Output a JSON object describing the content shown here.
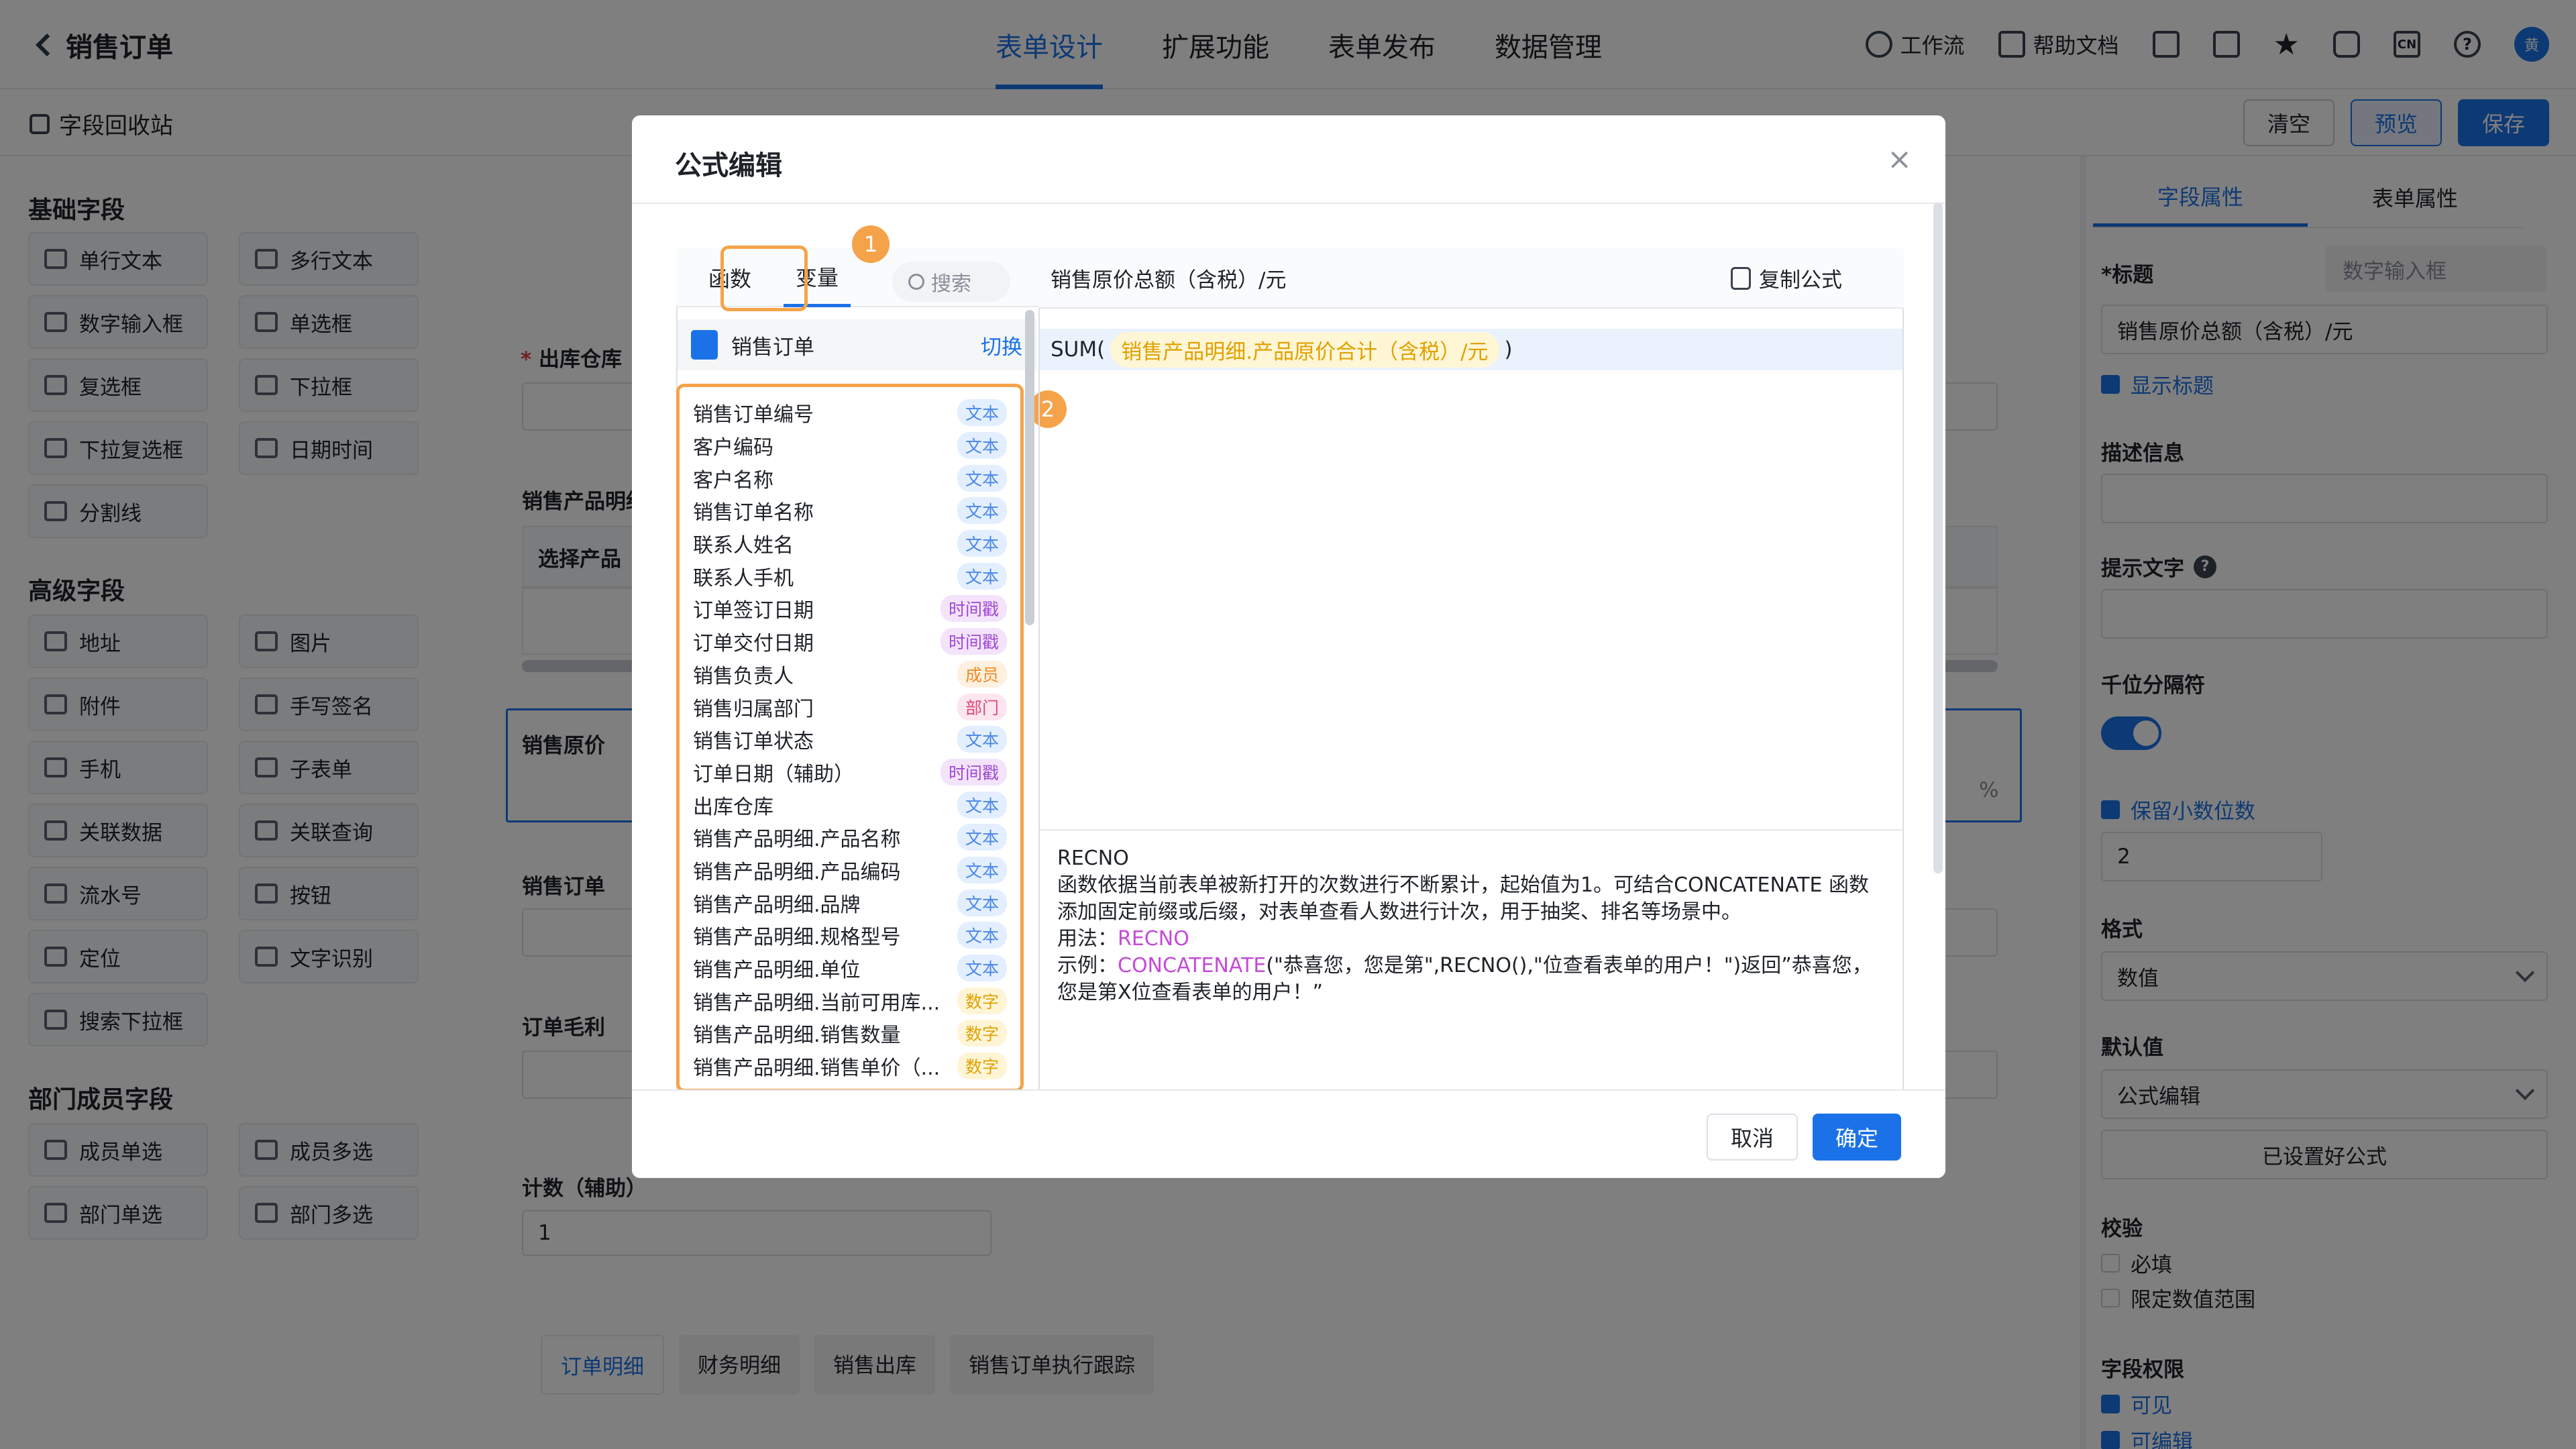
{
  "header": {
    "title": "销售订单",
    "tabs": [
      "表单设计",
      "扩展功能",
      "表单发布",
      "数据管理"
    ],
    "active_tab": 0,
    "workflow": "工作流",
    "help_doc": "帮助文档",
    "lang": "CN",
    "avatar": "黄"
  },
  "subbar": {
    "recycle": "字段回收站",
    "clear": "清空",
    "preview": "预览",
    "save": "保存"
  },
  "sidebar": {
    "basic_title": "基础字段",
    "basic": [
      "单行文本",
      "多行文本",
      "数字输入框",
      "单选框",
      "复选框",
      "下拉框",
      "下拉复选框",
      "日期时间",
      "分割线"
    ],
    "advanced_title": "高级字段",
    "advanced": [
      "地址",
      "图片",
      "附件",
      "手写签名",
      "手机",
      "子表单",
      "关联数据",
      "关联查询",
      "流水号",
      "按钮",
      "定位",
      "文字识别",
      "搜索下拉框"
    ],
    "dept_title": "部门成员字段",
    "dept": [
      "成员单选",
      "成员多选",
      "部门单选",
      "部门多选"
    ]
  },
  "canvas": {
    "warehouse_label": "出库仓库",
    "detail_label": "销售产品明细",
    "select_product": "选择产品",
    "cost_label": "销售原价",
    "order_label": "销售订单",
    "profit_label": "订单毛利",
    "count_label": "计数（辅助）",
    "count_value": "1",
    "percent": "%",
    "bottom_tabs": [
      "订单明细",
      "财务明细",
      "销售出库",
      "销售订单执行跟踪"
    ]
  },
  "right": {
    "tabs": [
      "字段属性",
      "表单属性"
    ],
    "title_label": "*标题",
    "title_type": "数字输入框",
    "title_value": "销售原价总额（含税）/元",
    "show_title": "显示标题",
    "desc_label": "描述信息",
    "hint_label": "提示文字",
    "thousands_label": "千位分隔符",
    "decimal_label": "保留小数位数",
    "decimal_value": "2",
    "format_label": "格式",
    "format_value": "数值",
    "default_label": "默认值",
    "default_value": "公式编辑",
    "formula_set": "已设置好公式",
    "check_label": "校验",
    "required": "必填",
    "range": "限定数值范围",
    "perm_label": "字段权限",
    "visible": "可见",
    "editable": "可编辑"
  },
  "modal": {
    "title": "公式编辑",
    "close": "×",
    "tab_func": "函数",
    "tab_var": "变量",
    "search_placeholder": "搜索",
    "source": "销售订单",
    "switch": "切换",
    "badge1": "1",
    "badge2": "2",
    "variables": [
      {
        "name": "销售订单编号",
        "tag": "文本",
        "kind": "text"
      },
      {
        "name": "客户编码",
        "tag": "文本",
        "kind": "text"
      },
      {
        "name": "客户名称",
        "tag": "文本",
        "kind": "text"
      },
      {
        "name": "销售订单名称",
        "tag": "文本",
        "kind": "text"
      },
      {
        "name": "联系人姓名",
        "tag": "文本",
        "kind": "text"
      },
      {
        "name": "联系人手机",
        "tag": "文本",
        "kind": "text"
      },
      {
        "name": "订单签订日期",
        "tag": "时间戳",
        "kind": "time"
      },
      {
        "name": "订单交付日期",
        "tag": "时间戳",
        "kind": "time"
      },
      {
        "name": "销售负责人",
        "tag": "成员",
        "kind": "member"
      },
      {
        "name": "销售归属部门",
        "tag": "部门",
        "kind": "dept"
      },
      {
        "name": "销售订单状态",
        "tag": "文本",
        "kind": "text"
      },
      {
        "name": "订单日期（辅助）",
        "tag": "时间戳",
        "kind": "time"
      },
      {
        "name": "出库仓库",
        "tag": "文本",
        "kind": "text"
      },
      {
        "name": "销售产品明细.产品名称",
        "tag": "文本",
        "kind": "text"
      },
      {
        "name": "销售产品明细.产品编码",
        "tag": "文本",
        "kind": "text"
      },
      {
        "name": "销售产品明细.品牌",
        "tag": "文本",
        "kind": "text"
      },
      {
        "name": "销售产品明细.规格型号",
        "tag": "文本",
        "kind": "text"
      },
      {
        "name": "销售产品明细.单位",
        "tag": "文本",
        "kind": "text"
      },
      {
        "name": "销售产品明细.当前可用库...",
        "tag": "数字",
        "kind": "num"
      },
      {
        "name": "销售产品明细.销售数量",
        "tag": "数字",
        "kind": "num"
      },
      {
        "name": "销售产品明细.销售单价（...",
        "tag": "数字",
        "kind": "num"
      }
    ],
    "field_name": "销售原价总额（含税）/元",
    "copy": "复制公式",
    "formula_prefix": "SUM(",
    "formula_arg": "销售产品明细.产品原价合计（含税）/元",
    "formula_suffix": ")",
    "help_title": "RECNO",
    "help_desc": "函数依据当前表单被新打开的次数进行不断累计，起始值为1。可结合CONCATENATE 函数添加固定前缀或后缀，对表单查看人数进行计次，用于抽奖、排名等场景中。",
    "usage_label": "用法：",
    "usage_kw": "RECNO",
    "example_label": "示例：",
    "example_kw": "CONCATENATE",
    "example_rest": "(\"恭喜您，您是第\",RECNO(),\"位查看表单的用户！\")返回”恭喜您，您是第X位查看表单的用户！”",
    "cancel": "取消",
    "ok": "确定"
  }
}
